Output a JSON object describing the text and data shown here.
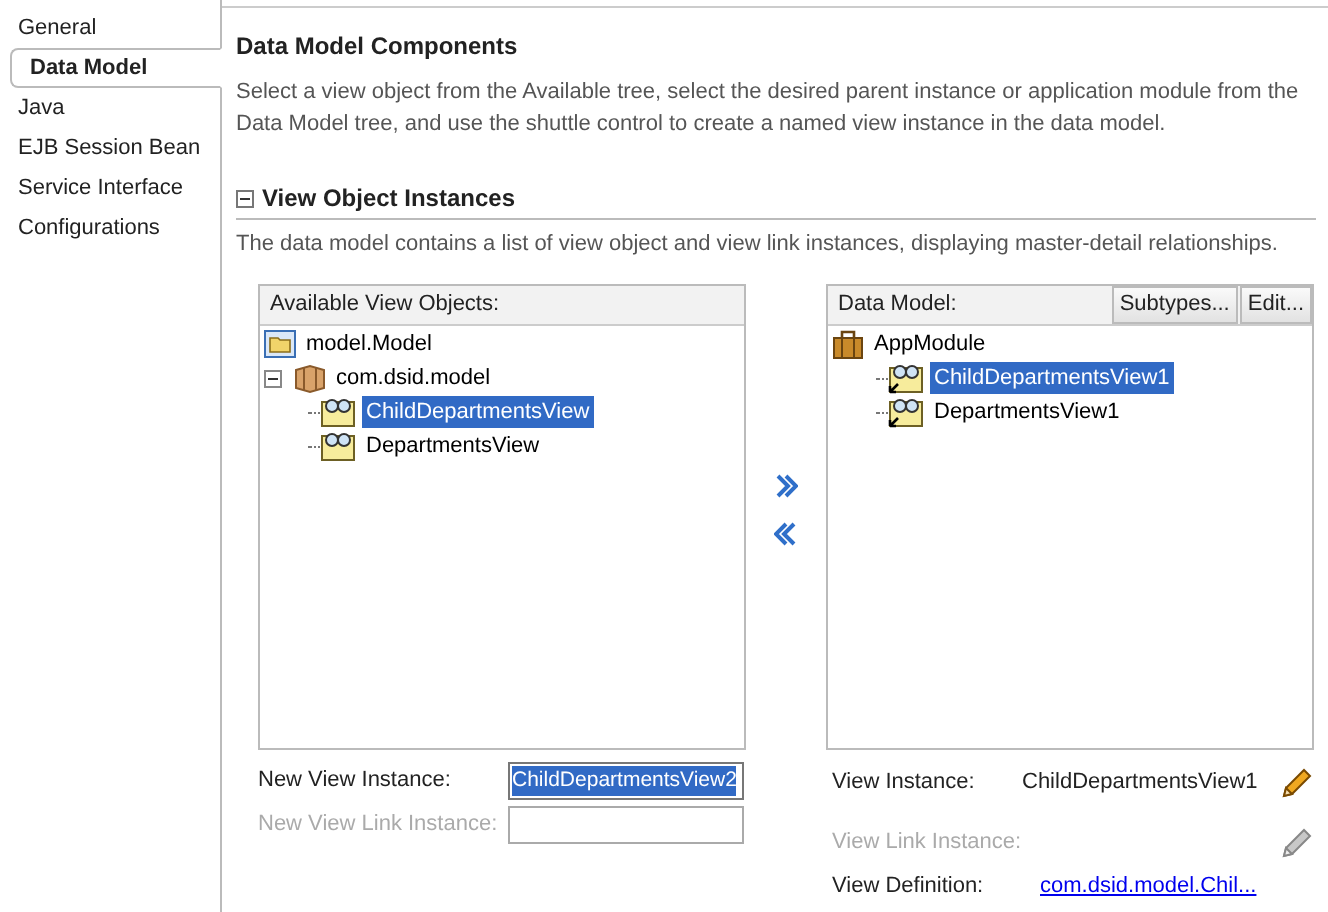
{
  "sidebar": {
    "items": [
      {
        "label": "General",
        "selected": false
      },
      {
        "label": "Data Model",
        "selected": true
      },
      {
        "label": "Java",
        "selected": false
      },
      {
        "label": "EJB Session Bean",
        "selected": false
      },
      {
        "label": "Service Interface",
        "selected": false
      },
      {
        "label": "Configurations",
        "selected": false
      }
    ]
  },
  "page": {
    "title": "Data Model Components",
    "description": "Select a view object from the Available tree, select the desired parent instance or application module from the Data Model tree, and use the shuttle control to create a named view instance in the data model."
  },
  "section": {
    "title": "View Object Instances",
    "expanded": true,
    "description": "The data model contains a list of view object and view link instances, displaying master-detail relationships."
  },
  "available": {
    "title": "Available View Objects:",
    "tree": [
      {
        "label": "model.Model",
        "kind": "project",
        "selected": false
      },
      {
        "label": "com.dsid.model",
        "kind": "package",
        "expanded": true,
        "selected": false,
        "children": [
          {
            "label": "ChildDepartmentsView",
            "kind": "view-object",
            "selected": true
          },
          {
            "label": "DepartmentsView",
            "kind": "view-object",
            "selected": false
          }
        ]
      }
    ]
  },
  "data_model": {
    "title": "Data Model:",
    "buttons": [
      "Subtypes...",
      "Edit..."
    ],
    "tree": [
      {
        "label": "AppModule",
        "kind": "app-module",
        "selected": false,
        "children": [
          {
            "label": "ChildDepartmentsView1",
            "kind": "view-instance",
            "selected": true
          },
          {
            "label": "DepartmentsView1",
            "kind": "view-instance",
            "selected": false
          }
        ]
      }
    ]
  },
  "new_view_instance": {
    "label": "New View Instance:",
    "value": "ChildDepartmentsView2",
    "disabled": false
  },
  "new_view_link_instance": {
    "label": "New View Link Instance:",
    "disabled": true
  },
  "view_instance": {
    "label": "View Instance:",
    "value": "ChildDepartmentsView1",
    "disabled": false
  },
  "view_link_instance": {
    "label": "View Link Instance:",
    "disabled": true
  },
  "view_definition": {
    "label": "View Definition:",
    "link": "com.dsid.model.Chil..."
  }
}
